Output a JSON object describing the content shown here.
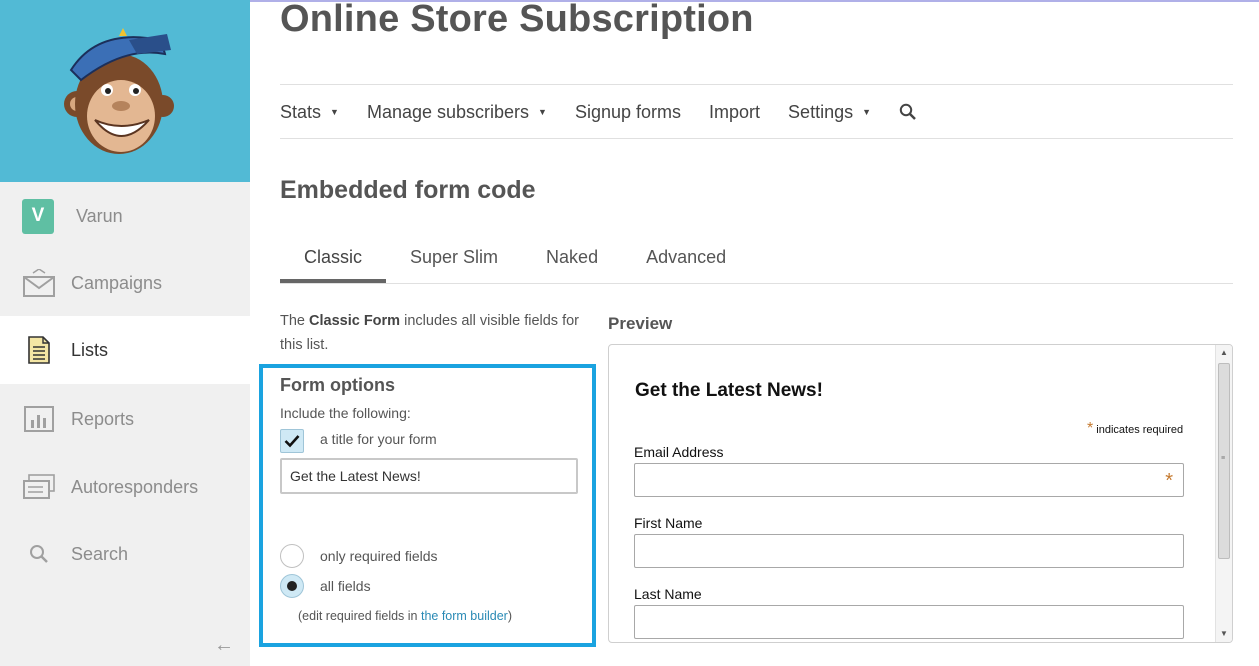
{
  "sidebar": {
    "user": {
      "initial": "V",
      "name": "Varun"
    },
    "items": [
      {
        "label": "Campaigns",
        "icon": "envelope-icon"
      },
      {
        "label": "Lists",
        "icon": "list-document-icon",
        "active": true
      },
      {
        "label": "Reports",
        "icon": "bar-chart-icon"
      },
      {
        "label": "Autoresponders",
        "icon": "stacked-mail-icon"
      },
      {
        "label": "Search",
        "icon": "search-icon"
      }
    ],
    "collapse_glyph": "←"
  },
  "page": {
    "title": "Online Store Subscription"
  },
  "topnav": {
    "items": [
      {
        "label": "Stats",
        "dropdown": true
      },
      {
        "label": "Manage subscribers",
        "dropdown": true
      },
      {
        "label": "Signup forms",
        "dropdown": false
      },
      {
        "label": "Import",
        "dropdown": false
      },
      {
        "label": "Settings",
        "dropdown": true
      }
    ],
    "caret": "▼",
    "search_icon": "search-icon"
  },
  "section": {
    "title": "Embedded form code"
  },
  "tabs": [
    {
      "label": "Classic",
      "active": true
    },
    {
      "label": "Super Slim",
      "active": false
    },
    {
      "label": "Naked",
      "active": false
    },
    {
      "label": "Advanced",
      "active": false
    }
  ],
  "description": {
    "prefix": "The ",
    "bold": "Classic Form",
    "suffix": " includes all visible fields for this list."
  },
  "form_options": {
    "title": "Form options",
    "include_label": "Include the following:",
    "title_checkbox": {
      "label": "a title for your form",
      "checked": true
    },
    "title_value": "Get the Latest News!",
    "radio_required": {
      "label": "only required fields",
      "selected": false
    },
    "radio_all": {
      "label": "all fields",
      "selected": true
    },
    "note_prefix": "(edit required fields in ",
    "note_link": "the form builder",
    "note_suffix": ")"
  },
  "preview": {
    "label": "Preview",
    "form_title": "Get the Latest News!",
    "required_star": "*",
    "required_text": "indicates required",
    "fields": [
      {
        "label": "Email Address",
        "required": true
      },
      {
        "label": "First Name",
        "required": false
      },
      {
        "label": "Last Name",
        "required": false
      }
    ]
  },
  "colors": {
    "brand": "#52bad5",
    "highlight_border": "#1aa3e0",
    "avatar": "#5fbfa3",
    "link": "#2a8ab5",
    "required_star": "#c57a30"
  }
}
